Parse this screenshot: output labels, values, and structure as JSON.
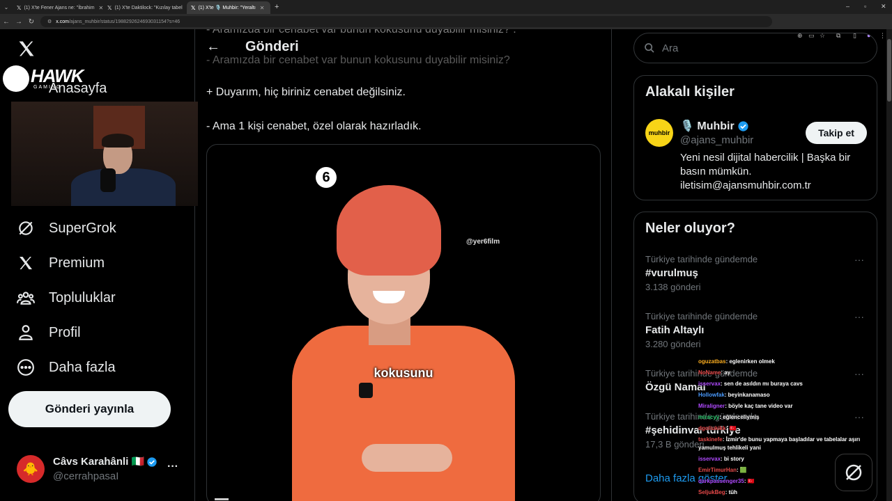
{
  "browser": {
    "tabs": [
      {
        "label": "(1) X'te Fener Ajans ne: \"İbrahim",
        "active": false
      },
      {
        "label": "(1) X'te Daktilock: \"Kızılay tabel",
        "active": false
      },
      {
        "label": "(1) X'te 🎙️ Muhbir: \"Yeraltı",
        "active": true
      }
    ],
    "new_tab": "+",
    "url_domain": "x.com",
    "url_path": "/ajans_muhbir/status/1988292624693031154?s=46"
  },
  "overlay": {
    "logo_text": "HAWK",
    "logo_sub": "GAMING"
  },
  "sidebar": {
    "home_label": "Anasayfa",
    "items": [
      {
        "label": "SuperGrok",
        "icon": "supergrok-icon"
      },
      {
        "label": "Premium",
        "icon": "x-icon"
      },
      {
        "label": "Topluluklar",
        "icon": "communities-icon"
      },
      {
        "label": "Profil",
        "icon": "profile-icon"
      },
      {
        "label": "Daha fazla",
        "icon": "more-icon"
      }
    ],
    "post_button": "Gönderi yayınla",
    "account": {
      "name": "Câvs Karahânli 🇮🇹",
      "handle": "@cerrahpasaI",
      "more": "···"
    }
  },
  "main": {
    "top_faded": "- Aramızda bir cenabet var bunun kokusunu duyabilir misiniz? .",
    "header_title": "Gönderi",
    "faded_line": "- Aramızda bir cenabet var bunun kokusunu duyabilir misiniz?",
    "lines": [
      "+ Duyarım, hiç biriniz cenabet değilsiniz.",
      "- Ama 1 kişi cenabet, özel olarak hazırladık."
    ],
    "video": {
      "badge": "6",
      "watermark": "@yer6film",
      "subtitle": "kokusunu"
    }
  },
  "right": {
    "search_placeholder": "Ara",
    "related": {
      "title": "Alakalı kişiler",
      "avatar_text": "muhbir",
      "name": "🎙️ Muhbir",
      "handle": "@ajans_muhbir",
      "bio": "Yeni nesil dijital habercilik | Başka bir basın mümkün. iletisim@ajansmuhbir.com.tr",
      "follow": "Takip et"
    },
    "trends": {
      "title": "Neler oluyor?",
      "items": [
        {
          "context": "Türkiye tarihinde gündemde",
          "name": "#vurulmuş",
          "count": "3.138 gönderi"
        },
        {
          "context": "Türkiye tarihinde gündemde",
          "name": "Fatih Altaylı",
          "count": "3.280 gönderi"
        },
        {
          "context": "Türkiye tarihinde gündemde",
          "name": "Özgü Namal",
          "count": ""
        },
        {
          "context": "Türkiye tarihinde gündemde",
          "name": "#şehidinvar türkiye",
          "count": "17,3 B gönderi"
        }
      ],
      "show_more": "Daha fazla göster"
    }
  },
  "chat": [
    {
      "user": "oguzatbas",
      "text": ": eglenirken olmek",
      "color": "#ffb020"
    },
    {
      "user": "NoName",
      "text": ": ay",
      "color": "#e84a4a"
    },
    {
      "user": "isservax",
      "text": ": sen de asıldın mı buraya cavs",
      "color": "#b04aff"
    },
    {
      "user": "Hollowfak",
      "text": ": beyinkanamaso",
      "color": "#4a9bff"
    },
    {
      "user": "Miraligner",
      "text": ": böyle kaç tane video var",
      "color": "#b04aff"
    },
    {
      "user": "miracyy",
      "text": ": eğlenceliymiş",
      "color": "#2ecc71"
    },
    {
      "user": "dgoliukikk",
      "text": ": 🇹🇷",
      "color": "#e84a4a"
    },
    {
      "user": "taskinefe",
      "text": ": İzmir'de bunu yapmaya başladılar ve tabelalar aşırı yamulmuş tehlikeli yani",
      "color": "#e84a4a"
    },
    {
      "user": "isservax",
      "text": ": bi story",
      "color": "#b04aff"
    },
    {
      "user": "EmirTimurHan",
      "text": ": 🟩",
      "color": "#e84a4a"
    },
    {
      "user": "darkpassenger35",
      "text": ": 🇹🇷",
      "color": "#b04aff"
    },
    {
      "user": "SeljukBeg",
      "text": ": tüh",
      "color": "#e84a4a"
    }
  ]
}
